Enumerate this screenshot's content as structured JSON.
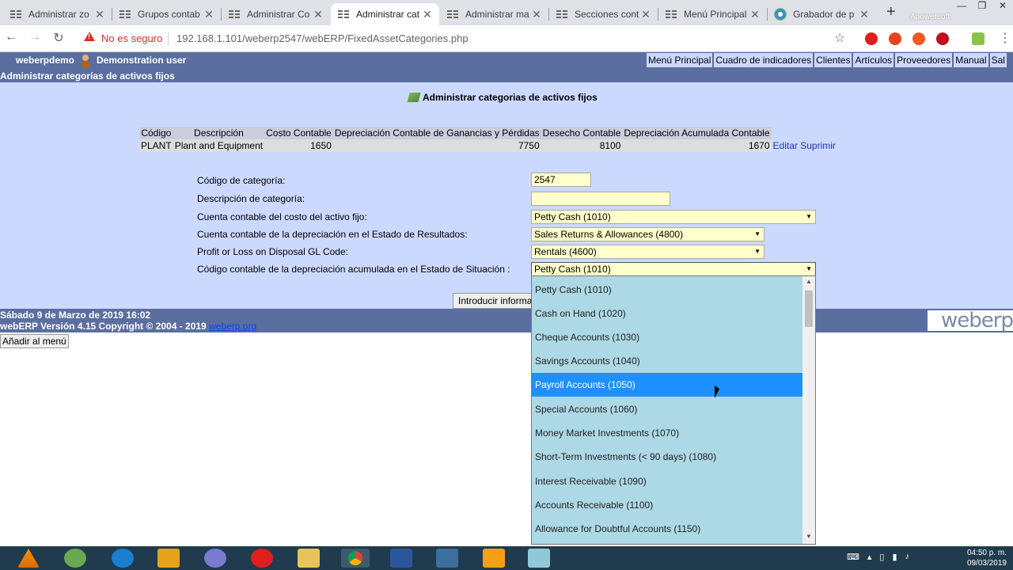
{
  "browser": {
    "tabs": [
      {
        "title": "Administrar zo",
        "icon": "grid-icon"
      },
      {
        "title": "Grupos contab",
        "icon": "grid-icon"
      },
      {
        "title": "Administrar Co",
        "icon": "grid-icon"
      },
      {
        "title": "Administrar cat",
        "icon": "grid-icon",
        "active": true
      },
      {
        "title": "Administrar ma",
        "icon": "grid-icon"
      },
      {
        "title": "Secciones cont",
        "icon": "grid-icon"
      },
      {
        "title": "Menú Principal",
        "icon": "grid-icon"
      },
      {
        "title": "Grabador de p",
        "icon": "globe-icon"
      }
    ],
    "new_tab": "+",
    "overlay_text": "Apowersoft",
    "security": "No es seguro",
    "url": "192.168.1.101/weberp2547/webERP/FixedAssetCategories.php"
  },
  "header": {
    "company": "weberpdemo",
    "user": "Demonstration user",
    "subtitle": "Administrar categorías de activos fijos",
    "menu": [
      "Menú Principal",
      "Cuadro de indicadores",
      "Clientes",
      "Artículos",
      "Proveedores",
      "Manual",
      "Sal"
    ]
  },
  "main": {
    "title": "Administrar categorias de activos fijos",
    "table": {
      "headers": [
        "Código",
        "Descripción",
        "Costo Contable",
        "Depreciación Contable de Ganancias y Pérdidas",
        "Desecho Contable",
        "Depreciación Acumulada Contable"
      ],
      "rows": [
        {
          "code": "PLANT",
          "description": "Plant and Equipment",
          "cost": "1650",
          "depreciation_pl": "7750",
          "disposal": "8100",
          "accum_depreciation": "1670",
          "edit": "Editar",
          "delete": "Suprimir"
        }
      ]
    },
    "form": {
      "code_label": "Código de categoría:",
      "code_value": "2547",
      "desc_label": "Descripción de categoría:",
      "desc_value": "",
      "cost_label": "Cuenta contable del costo del activo fijo:",
      "cost_value": "Petty Cash (1010)",
      "dep_label": "Cuenta contable de la depreciación en el Estado de Resultados:",
      "dep_value": "Sales Returns & Allowances (4800)",
      "disposal_label": "Profit or Loss on Disposal GL Code:",
      "disposal_value": "Rentals (4600)",
      "accum_label": "Código contable de la depreciación acumulada en el Estado de Situación :",
      "accum_value": "Petty Cash (1010)",
      "submit": "Introducir información"
    },
    "dropdown_options": [
      "Petty Cash (1010)",
      "Cash on Hand (1020)",
      "Cheque Accounts (1030)",
      "Savings Accounts (1040)",
      "Payroll Accounts (1050)",
      "Special Accounts (1060)",
      "Money Market Investments (1070)",
      "Short-Term Investments (< 90 days) (1080)",
      "Interest Receivable (1090)",
      "Accounts Receivable (1100)",
      "Allowance for Doubtful Accounts (1150)"
    ],
    "dropdown_highlighted": "Payroll Accounts (1050)"
  },
  "footer": {
    "date": "Sábado 9 de Marzo de 2019 16:02",
    "version": "webERP Versión 4.15 Copyright © 2004 - 2019",
    "link": "weberp.org",
    "logo": "weberp",
    "add_menu": "Añadir al menú"
  },
  "taskbar": {
    "time": "04:50 p. m.",
    "date": "09/03/2019"
  },
  "colors": {
    "header_bg": "#5a6ea0",
    "content_bg": "#ccd9ff",
    "dropdown_bg": "#add8e6",
    "highlight": "#1e90ff",
    "input_bg": "#ffffcc"
  }
}
